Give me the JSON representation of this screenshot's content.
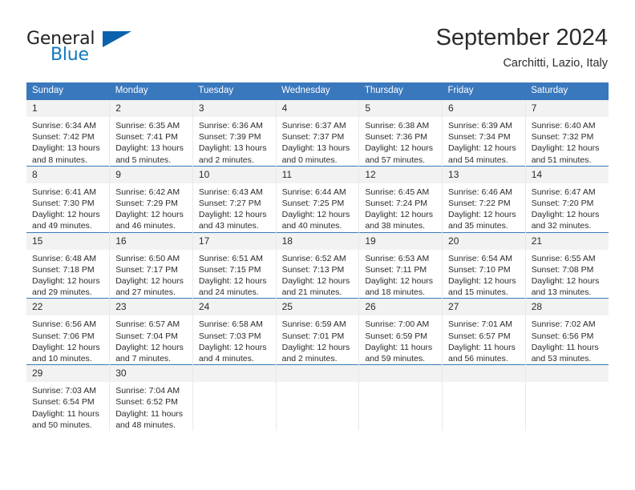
{
  "brand": {
    "word1": "General",
    "word2": "Blue",
    "triangle_color": "#0b62ac",
    "blue_color": "#1278be"
  },
  "header": {
    "title": "September 2024",
    "location": "Carchitti, Lazio, Italy"
  },
  "theme": {
    "header_bg": "#3a78bd",
    "header_text": "#ffffff",
    "daynum_bg": "#f2f2f2",
    "cell_border": "#e8e8e8",
    "row_border": "#3a78bd"
  },
  "weekdays": [
    "Sunday",
    "Monday",
    "Tuesday",
    "Wednesday",
    "Thursday",
    "Friday",
    "Saturday"
  ],
  "weeks": [
    [
      {
        "day": "1",
        "sunrise": "Sunrise: 6:34 AM",
        "sunset": "Sunset: 7:42 PM",
        "daylight1": "Daylight: 13 hours",
        "daylight2": "and 8 minutes."
      },
      {
        "day": "2",
        "sunrise": "Sunrise: 6:35 AM",
        "sunset": "Sunset: 7:41 PM",
        "daylight1": "Daylight: 13 hours",
        "daylight2": "and 5 minutes."
      },
      {
        "day": "3",
        "sunrise": "Sunrise: 6:36 AM",
        "sunset": "Sunset: 7:39 PM",
        "daylight1": "Daylight: 13 hours",
        "daylight2": "and 2 minutes."
      },
      {
        "day": "4",
        "sunrise": "Sunrise: 6:37 AM",
        "sunset": "Sunset: 7:37 PM",
        "daylight1": "Daylight: 13 hours",
        "daylight2": "and 0 minutes."
      },
      {
        "day": "5",
        "sunrise": "Sunrise: 6:38 AM",
        "sunset": "Sunset: 7:36 PM",
        "daylight1": "Daylight: 12 hours",
        "daylight2": "and 57 minutes."
      },
      {
        "day": "6",
        "sunrise": "Sunrise: 6:39 AM",
        "sunset": "Sunset: 7:34 PM",
        "daylight1": "Daylight: 12 hours",
        "daylight2": "and 54 minutes."
      },
      {
        "day": "7",
        "sunrise": "Sunrise: 6:40 AM",
        "sunset": "Sunset: 7:32 PM",
        "daylight1": "Daylight: 12 hours",
        "daylight2": "and 51 minutes."
      }
    ],
    [
      {
        "day": "8",
        "sunrise": "Sunrise: 6:41 AM",
        "sunset": "Sunset: 7:30 PM",
        "daylight1": "Daylight: 12 hours",
        "daylight2": "and 49 minutes."
      },
      {
        "day": "9",
        "sunrise": "Sunrise: 6:42 AM",
        "sunset": "Sunset: 7:29 PM",
        "daylight1": "Daylight: 12 hours",
        "daylight2": "and 46 minutes."
      },
      {
        "day": "10",
        "sunrise": "Sunrise: 6:43 AM",
        "sunset": "Sunset: 7:27 PM",
        "daylight1": "Daylight: 12 hours",
        "daylight2": "and 43 minutes."
      },
      {
        "day": "11",
        "sunrise": "Sunrise: 6:44 AM",
        "sunset": "Sunset: 7:25 PM",
        "daylight1": "Daylight: 12 hours",
        "daylight2": "and 40 minutes."
      },
      {
        "day": "12",
        "sunrise": "Sunrise: 6:45 AM",
        "sunset": "Sunset: 7:24 PM",
        "daylight1": "Daylight: 12 hours",
        "daylight2": "and 38 minutes."
      },
      {
        "day": "13",
        "sunrise": "Sunrise: 6:46 AM",
        "sunset": "Sunset: 7:22 PM",
        "daylight1": "Daylight: 12 hours",
        "daylight2": "and 35 minutes."
      },
      {
        "day": "14",
        "sunrise": "Sunrise: 6:47 AM",
        "sunset": "Sunset: 7:20 PM",
        "daylight1": "Daylight: 12 hours",
        "daylight2": "and 32 minutes."
      }
    ],
    [
      {
        "day": "15",
        "sunrise": "Sunrise: 6:48 AM",
        "sunset": "Sunset: 7:18 PM",
        "daylight1": "Daylight: 12 hours",
        "daylight2": "and 29 minutes."
      },
      {
        "day": "16",
        "sunrise": "Sunrise: 6:50 AM",
        "sunset": "Sunset: 7:17 PM",
        "daylight1": "Daylight: 12 hours",
        "daylight2": "and 27 minutes."
      },
      {
        "day": "17",
        "sunrise": "Sunrise: 6:51 AM",
        "sunset": "Sunset: 7:15 PM",
        "daylight1": "Daylight: 12 hours",
        "daylight2": "and 24 minutes."
      },
      {
        "day": "18",
        "sunrise": "Sunrise: 6:52 AM",
        "sunset": "Sunset: 7:13 PM",
        "daylight1": "Daylight: 12 hours",
        "daylight2": "and 21 minutes."
      },
      {
        "day": "19",
        "sunrise": "Sunrise: 6:53 AM",
        "sunset": "Sunset: 7:11 PM",
        "daylight1": "Daylight: 12 hours",
        "daylight2": "and 18 minutes."
      },
      {
        "day": "20",
        "sunrise": "Sunrise: 6:54 AM",
        "sunset": "Sunset: 7:10 PM",
        "daylight1": "Daylight: 12 hours",
        "daylight2": "and 15 minutes."
      },
      {
        "day": "21",
        "sunrise": "Sunrise: 6:55 AM",
        "sunset": "Sunset: 7:08 PM",
        "daylight1": "Daylight: 12 hours",
        "daylight2": "and 13 minutes."
      }
    ],
    [
      {
        "day": "22",
        "sunrise": "Sunrise: 6:56 AM",
        "sunset": "Sunset: 7:06 PM",
        "daylight1": "Daylight: 12 hours",
        "daylight2": "and 10 minutes."
      },
      {
        "day": "23",
        "sunrise": "Sunrise: 6:57 AM",
        "sunset": "Sunset: 7:04 PM",
        "daylight1": "Daylight: 12 hours",
        "daylight2": "and 7 minutes."
      },
      {
        "day": "24",
        "sunrise": "Sunrise: 6:58 AM",
        "sunset": "Sunset: 7:03 PM",
        "daylight1": "Daylight: 12 hours",
        "daylight2": "and 4 minutes."
      },
      {
        "day": "25",
        "sunrise": "Sunrise: 6:59 AM",
        "sunset": "Sunset: 7:01 PM",
        "daylight1": "Daylight: 12 hours",
        "daylight2": "and 2 minutes."
      },
      {
        "day": "26",
        "sunrise": "Sunrise: 7:00 AM",
        "sunset": "Sunset: 6:59 PM",
        "daylight1": "Daylight: 11 hours",
        "daylight2": "and 59 minutes."
      },
      {
        "day": "27",
        "sunrise": "Sunrise: 7:01 AM",
        "sunset": "Sunset: 6:57 PM",
        "daylight1": "Daylight: 11 hours",
        "daylight2": "and 56 minutes."
      },
      {
        "day": "28",
        "sunrise": "Sunrise: 7:02 AM",
        "sunset": "Sunset: 6:56 PM",
        "daylight1": "Daylight: 11 hours",
        "daylight2": "and 53 minutes."
      }
    ],
    [
      {
        "day": "29",
        "sunrise": "Sunrise: 7:03 AM",
        "sunset": "Sunset: 6:54 PM",
        "daylight1": "Daylight: 11 hours",
        "daylight2": "and 50 minutes."
      },
      {
        "day": "30",
        "sunrise": "Sunrise: 7:04 AM",
        "sunset": "Sunset: 6:52 PM",
        "daylight1": "Daylight: 11 hours",
        "daylight2": "and 48 minutes."
      },
      {
        "day": "",
        "sunrise": "",
        "sunset": "",
        "daylight1": "",
        "daylight2": ""
      },
      {
        "day": "",
        "sunrise": "",
        "sunset": "",
        "daylight1": "",
        "daylight2": ""
      },
      {
        "day": "",
        "sunrise": "",
        "sunset": "",
        "daylight1": "",
        "daylight2": ""
      },
      {
        "day": "",
        "sunrise": "",
        "sunset": "",
        "daylight1": "",
        "daylight2": ""
      },
      {
        "day": "",
        "sunrise": "",
        "sunset": "",
        "daylight1": "",
        "daylight2": ""
      }
    ]
  ]
}
